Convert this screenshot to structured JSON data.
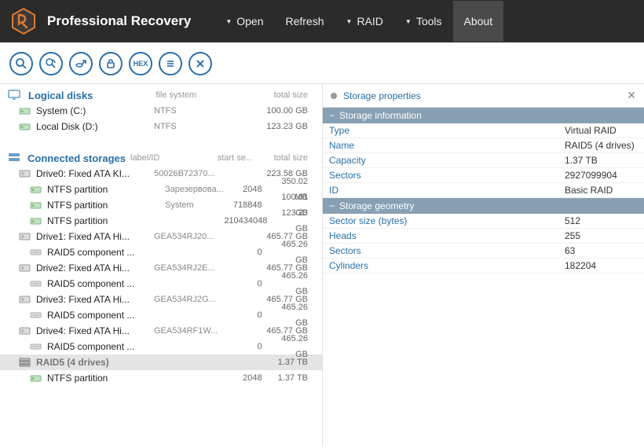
{
  "app": {
    "title": "Professional Recovery"
  },
  "menu": {
    "open": "Open",
    "refresh": "Refresh",
    "raid": "RAID",
    "tools": "Tools",
    "about": "About"
  },
  "toolbar": {
    "hex_label": "HEX"
  },
  "sections": {
    "logical": {
      "title": "Logical disks",
      "headers": {
        "fs": "file system",
        "size": "total size"
      },
      "items": [
        {
          "name": "System (C:)",
          "fs": "NTFS",
          "size": "100.00 GB"
        },
        {
          "name": "Local Disk (D:)",
          "fs": "NTFS",
          "size": "123.23 GB"
        }
      ]
    },
    "connected": {
      "title": "Connected storages",
      "headers": {
        "label": "label/ID",
        "start": "start se...",
        "size": "total size"
      },
      "items": [
        {
          "name": "Drive0: Fixed ATA KI...",
          "label": "50026B72370...",
          "start": "",
          "size": "223.58 GB",
          "icon": "disk"
        },
        {
          "name": "NTFS partition",
          "label": "Зарезервова...",
          "start": "2048",
          "size": "350.02 MB",
          "icon": "vol",
          "indent": 1
        },
        {
          "name": "NTFS partition",
          "label": "System",
          "start": "718848",
          "size": "100.01 GB",
          "icon": "vol",
          "indent": 1
        },
        {
          "name": "NTFS partition",
          "label": "",
          "start": "210434048",
          "size": "123.23 GB",
          "icon": "vol",
          "indent": 1
        },
        {
          "name": "Drive1: Fixed ATA Hi...",
          "label": "GEA534RJ20...",
          "start": "",
          "size": "465.77 GB",
          "icon": "disk"
        },
        {
          "name": "RAID5 component ...",
          "label": "",
          "start": "0",
          "size": "465.26 GB",
          "icon": "comp",
          "indent": 1
        },
        {
          "name": "Drive2: Fixed ATA Hi...",
          "label": "GEA534RJ2E...",
          "start": "",
          "size": "465.77 GB",
          "icon": "disk"
        },
        {
          "name": "RAID5 component ...",
          "label": "",
          "start": "0",
          "size": "465.26 GB",
          "icon": "comp",
          "indent": 1
        },
        {
          "name": "Drive3: Fixed ATA Hi...",
          "label": "GEA534RJ2G...",
          "start": "",
          "size": "465.77 GB",
          "icon": "disk"
        },
        {
          "name": "RAID5 component ...",
          "label": "",
          "start": "0",
          "size": "465.26 GB",
          "icon": "comp",
          "indent": 1
        },
        {
          "name": "Drive4: Fixed ATA Hi...",
          "label": "GEA534RF1W...",
          "start": "",
          "size": "465.77 GB",
          "icon": "disk"
        },
        {
          "name": "RAID5 component ...",
          "label": "",
          "start": "0",
          "size": "465.26 GB",
          "icon": "comp",
          "indent": 1
        },
        {
          "name": "RAID5 (4 drives)",
          "label": "",
          "start": "",
          "size": "1.37 TB",
          "icon": "raid",
          "selected": true,
          "raid_head": true
        },
        {
          "name": "NTFS partition",
          "label": "",
          "start": "2048",
          "size": "1.37 TB",
          "icon": "vol",
          "indent": 1
        }
      ]
    }
  },
  "panel": {
    "title": "Storage properties",
    "groups": [
      {
        "title": "Storage information",
        "rows": [
          {
            "k": "Type",
            "v": "Virtual RAID"
          },
          {
            "k": "Name",
            "v": "RAID5 (4 drives)"
          },
          {
            "k": "Capacity",
            "v": "1.37 TB"
          },
          {
            "k": "Sectors",
            "v": "2927099904"
          },
          {
            "k": "ID",
            "v": "Basic RAID"
          }
        ]
      },
      {
        "title": "Storage geometry",
        "rows": [
          {
            "k": "Sector size (bytes)",
            "v": "512"
          },
          {
            "k": "Heads",
            "v": "255"
          },
          {
            "k": "Sectors",
            "v": "63"
          },
          {
            "k": "Cylinders",
            "v": "182204"
          }
        ]
      }
    ]
  }
}
